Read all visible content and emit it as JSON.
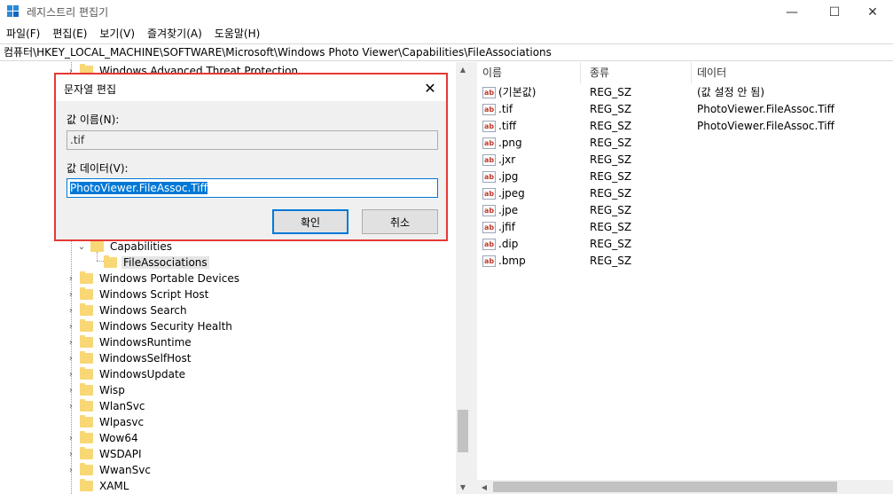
{
  "window": {
    "title": "레지스트리 편집기",
    "minimize_glyph": "—",
    "maximize_glyph": "☐",
    "close_glyph": "✕"
  },
  "menu": [
    "파일(F)",
    "편집(E)",
    "보기(V)",
    "즐겨찾기(A)",
    "도움말(H)"
  ],
  "address": "컴퓨터\\HKEY_LOCAL_MACHINE\\SOFTWARE\\Microsoft\\Windows Photo Viewer\\Capabilities\\FileAssociations",
  "tree": {
    "partial_top": "Windows Advanced Threat Protection",
    "capabilities": "Capabilities",
    "file_associations": "FileAssociations",
    "items": [
      "Windows Portable Devices",
      "Windows Script Host",
      "Windows Search",
      "Windows Security Health",
      "WindowsRuntime",
      "WindowsSelfHost",
      "WindowsUpdate",
      "Wisp",
      "WlanSvc",
      "Wlpasvc",
      "Wow64",
      "WSDAPI",
      "WwanSvc",
      "XAML"
    ]
  },
  "list": {
    "columns": [
      "이름",
      "종류",
      "데이터"
    ],
    "icon_glyph": "ab",
    "rows": [
      {
        "name": "(기본값)",
        "type": "REG_SZ",
        "data": "(값 설정 안 됨)"
      },
      {
        "name": ".tif",
        "type": "REG_SZ",
        "data": "PhotoViewer.FileAssoc.Tiff"
      },
      {
        "name": ".tiff",
        "type": "REG_SZ",
        "data": "PhotoViewer.FileAssoc.Tiff"
      },
      {
        "name": ".png",
        "type": "REG_SZ",
        "data": ""
      },
      {
        "name": ".jxr",
        "type": "REG_SZ",
        "data": ""
      },
      {
        "name": ".jpg",
        "type": "REG_SZ",
        "data": ""
      },
      {
        "name": ".jpeg",
        "type": "REG_SZ",
        "data": ""
      },
      {
        "name": ".jpe",
        "type": "REG_SZ",
        "data": ""
      },
      {
        "name": ".jfif",
        "type": "REG_SZ",
        "data": ""
      },
      {
        "name": ".dip",
        "type": "REG_SZ",
        "data": ""
      },
      {
        "name": ".bmp",
        "type": "REG_SZ",
        "data": ""
      }
    ]
  },
  "dialog": {
    "title": "문자열 편집",
    "value_name_label": "값 이름(N):",
    "value_name": ".tif",
    "value_data_label": "값 데이터(V):",
    "value_data": "PhotoViewer.FileAssoc.Tiff",
    "ok_label": "확인",
    "cancel_label": "취소",
    "close_glyph": "✕"
  },
  "colors": {
    "highlight_border": "#e53935",
    "selection": "#0078d7",
    "folder": "#f8d775"
  }
}
